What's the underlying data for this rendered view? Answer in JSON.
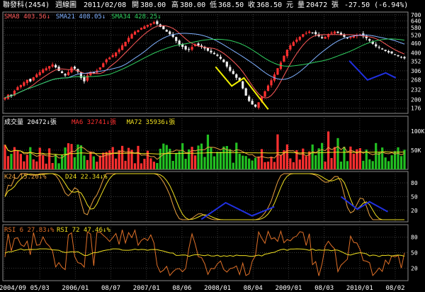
{
  "header": {
    "stock_name": "聯發科(2454)",
    "chart_label": "週線圖",
    "date": "2011/02/08",
    "open_label": "開",
    "open": "380.00",
    "high_label": "高",
    "high": "380.00",
    "low_label": "低",
    "low": "368.50",
    "close_label": "收",
    "close": "368.50",
    "currency_label": "元",
    "volume_label": "量",
    "volume": "20472",
    "volume_unit": "張",
    "change": "-27.50 (-6.94%)"
  },
  "colors": {
    "background": "#000000",
    "grid": "#3a3a3a",
    "axis": "#8a8a8a",
    "up": "#ff3030",
    "down": "#f0f0f0",
    "vol_down": "#22c022",
    "sma8": "#ff5a5a",
    "sma21": "#7fb0ff",
    "sma34": "#30d060",
    "k": "#e8a040",
    "d": "#f0e020",
    "rsi6": "#e07028",
    "rsi72": "#f0e020",
    "annot_yellow": "#f0f000",
    "annot_blue": "#2030e0"
  },
  "chart_data": {
    "type": "candlestick",
    "x_labels": [
      "2004/09",
      "05/03",
      "2006/01",
      "08/07",
      "2007/01",
      "08/06",
      "2008/01",
      "08/04",
      "2009/01",
      "08/03",
      "2010/01",
      "08/02"
    ],
    "price_panel": {
      "ma_legend": [
        {
          "name": "SMA8",
          "value": "403.56",
          "arrow": "↓"
        },
        {
          "name": "SMA21",
          "value": "408.05",
          "arrow": "↓"
        },
        {
          "name": "SMA34",
          "value": "428.25",
          "arrow": "↓"
        }
      ],
      "y_ticks": [
        "700",
        "640",
        "580",
        "520",
        "460",
        "400",
        "352",
        "306",
        "268",
        "232",
        "200",
        "176"
      ],
      "ylim": [
        170,
        700
      ],
      "close": [
        205,
        215,
        212,
        228,
        240,
        248,
        258,
        268,
        262,
        278,
        290,
        300,
        312,
        318,
        328,
        336,
        322,
        306,
        296,
        286,
        300,
        322,
        316,
        302,
        276,
        262,
        286,
        302,
        296,
        308,
        322,
        342,
        362,
        372,
        386,
        402,
        420,
        446,
        470,
        498,
        526,
        546,
        558,
        578,
        590,
        604,
        616,
        628,
        612,
        586,
        566,
        546,
        526,
        506,
        476,
        452,
        436,
        420,
        418,
        436,
        452,
        446,
        436,
        426,
        412,
        402,
        392,
        382,
        366,
        348,
        326,
        306,
        292,
        276,
        262,
        236,
        212,
        196,
        186,
        180,
        192,
        210,
        226,
        246,
        266,
        290,
        318,
        346,
        382,
        418,
        446,
        468,
        486,
        506,
        526,
        536,
        546,
        536,
        526,
        510,
        496,
        506,
        526,
        538,
        546,
        536,
        520,
        506,
        498,
        506,
        512,
        520,
        526,
        510,
        496,
        478,
        456,
        440,
        432,
        420,
        410,
        402,
        396,
        388,
        380,
        372,
        368.5
      ],
      "annot_yellow_polyline": [
        [
          0.525,
          0.54
        ],
        [
          0.565,
          0.73
        ],
        [
          0.595,
          0.65
        ],
        [
          0.655,
          0.96
        ]
      ],
      "annot_blue_polyline": [
        [
          0.855,
          0.48
        ],
        [
          0.9,
          0.67
        ],
        [
          0.945,
          0.6
        ],
        [
          0.97,
          0.65
        ]
      ]
    },
    "volume_panel": {
      "legend": [
        {
          "name": "成交量",
          "value": "20472",
          "arrow": "↓",
          "unit": "張"
        },
        {
          "name": "MA6",
          "value": "32741",
          "arrow": "↓",
          "unit": "張"
        },
        {
          "name": "MA72",
          "value": "35936",
          "arrow": "↓",
          "unit": "張"
        }
      ],
      "y_ticks": [
        "100K",
        "50K"
      ],
      "ylim": [
        0,
        120000
      ]
    },
    "kd_panel": {
      "legend": [
        {
          "name": "K24",
          "value": "15.20",
          "arrow": "↓",
          "unit": "%"
        },
        {
          "name": "D24",
          "value": "22.34",
          "arrow": "↓",
          "unit": "%"
        }
      ],
      "y_ticks": [
        "80",
        "50",
        "20"
      ],
      "ylim": [
        0,
        100
      ],
      "annot_blue_left": [
        [
          0.49,
          0.95
        ],
        [
          0.55,
          0.62
        ],
        [
          0.615,
          0.88
        ],
        [
          0.67,
          0.7
        ]
      ],
      "annot_blue_right": [
        [
          0.835,
          0.5
        ],
        [
          0.875,
          0.75
        ],
        [
          0.905,
          0.6
        ],
        [
          0.95,
          0.8
        ]
      ]
    },
    "rsi_panel": {
      "legend": [
        {
          "name": "RSI 6",
          "value": "27.83",
          "arrow": "↓",
          "unit": "%"
        },
        {
          "name": "RSI 72",
          "value": "47.46",
          "arrow": "↓",
          "unit": "%"
        }
      ],
      "y_ticks": [
        "80",
        "50",
        "20"
      ],
      "ylim": [
        0,
        100
      ]
    }
  }
}
